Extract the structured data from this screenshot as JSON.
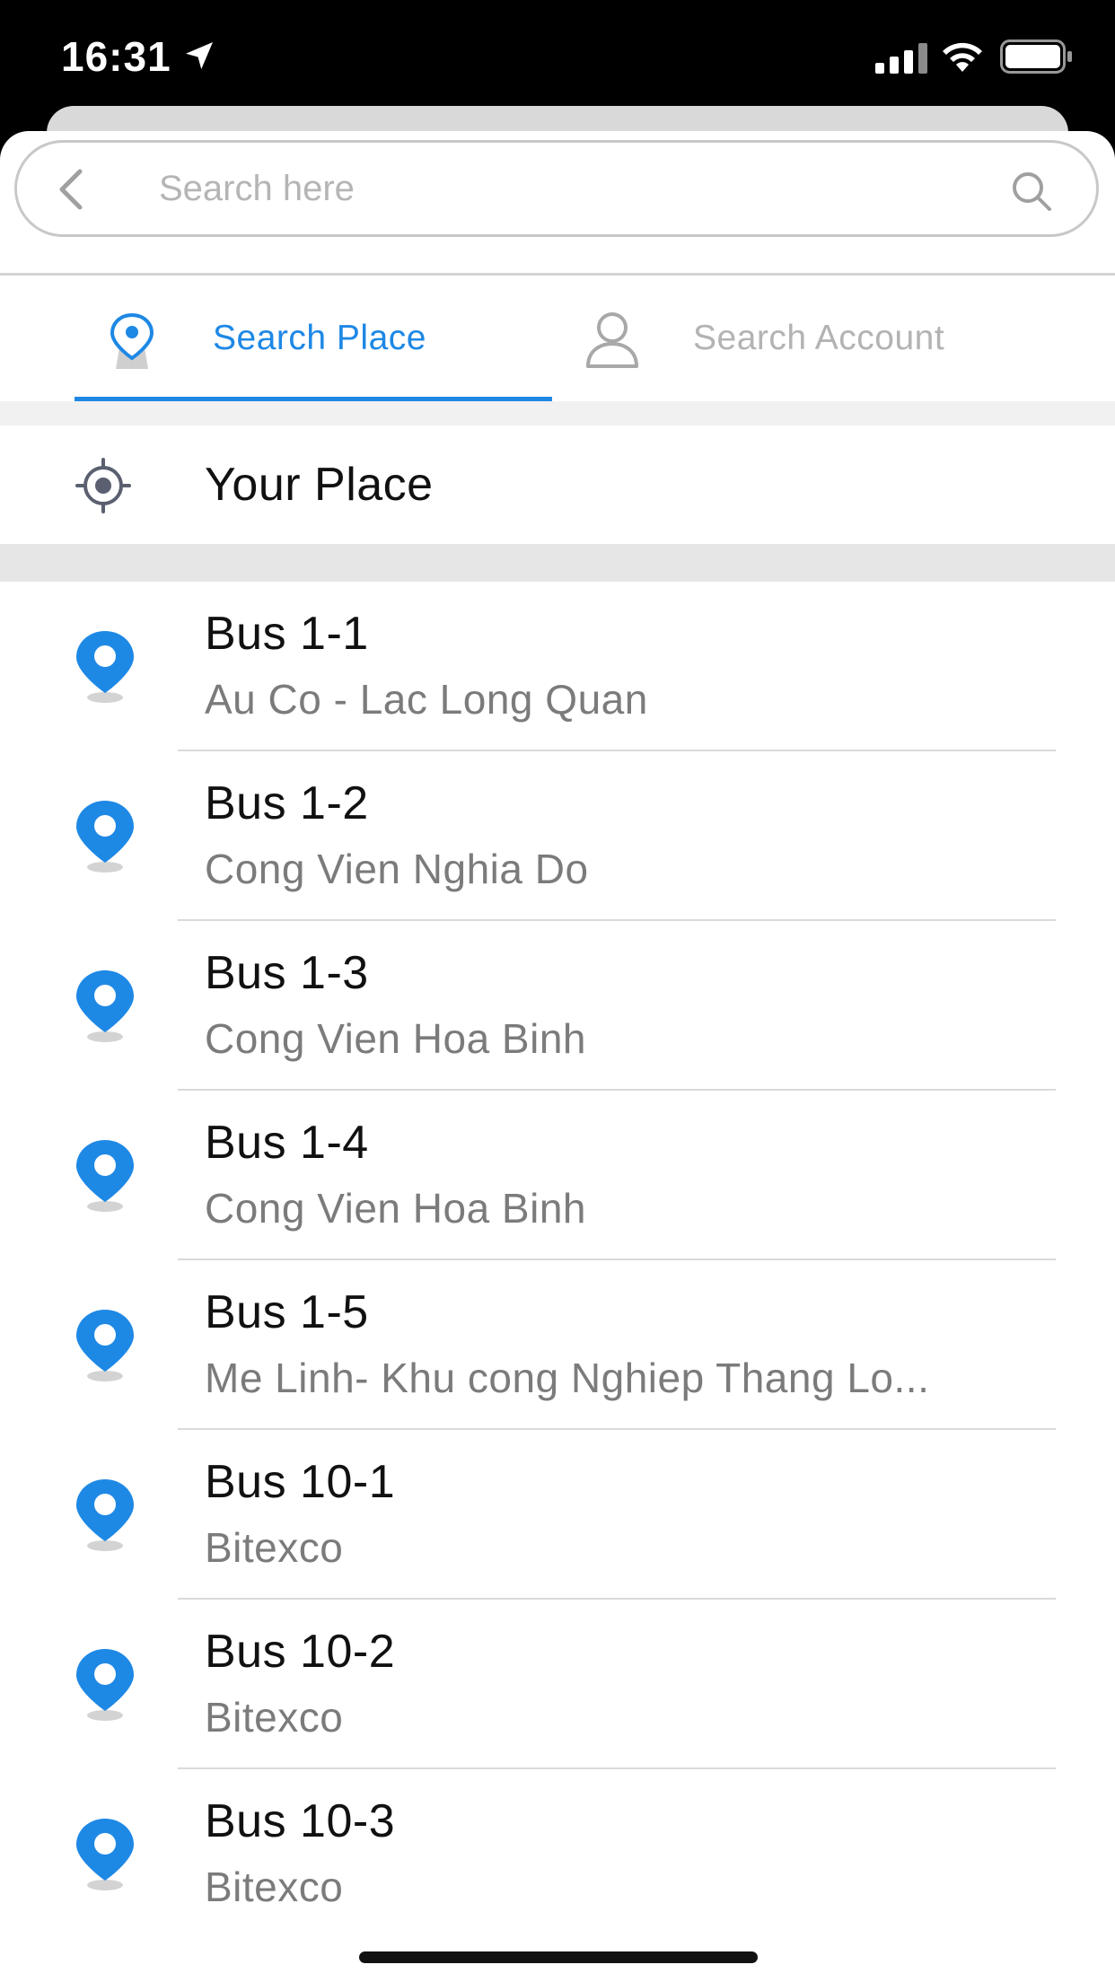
{
  "status_bar": {
    "time": "16:31",
    "icons": [
      "location-arrow-icon",
      "cellular-signal-icon",
      "wifi-icon",
      "battery-icon"
    ]
  },
  "search": {
    "placeholder": "Search here",
    "value": ""
  },
  "tabs": [
    {
      "label": "Search Place",
      "icon": "map-pin-icon",
      "active": true
    },
    {
      "label": "Search Account",
      "icon": "user-icon",
      "active": false
    }
  ],
  "your_place": {
    "label": "Your Place",
    "icon": "target-icon"
  },
  "results": [
    {
      "title": "Bus 1-1",
      "subtitle": "Au Co - Lac Long Quan"
    },
    {
      "title": "Bus 1-2",
      "subtitle": "Cong Vien Nghia Do"
    },
    {
      "title": "Bus 1-3",
      "subtitle": "Cong Vien Hoa Binh"
    },
    {
      "title": "Bus 1-4",
      "subtitle": "Cong Vien Hoa Binh"
    },
    {
      "title": "Bus 1-5",
      "subtitle": "Me Linh- Khu cong Nghiep Thang Lo..."
    },
    {
      "title": "Bus 10-1",
      "subtitle": "Bitexco"
    },
    {
      "title": "Bus 10-2",
      "subtitle": "Bitexco"
    },
    {
      "title": "Bus 10-3",
      "subtitle": "Bitexco"
    }
  ],
  "colors": {
    "accent": "#1e88e5",
    "inactive_tab": "#b3b3b3",
    "subtitle": "#7b7b7b",
    "pin": "#1e88e5"
  }
}
